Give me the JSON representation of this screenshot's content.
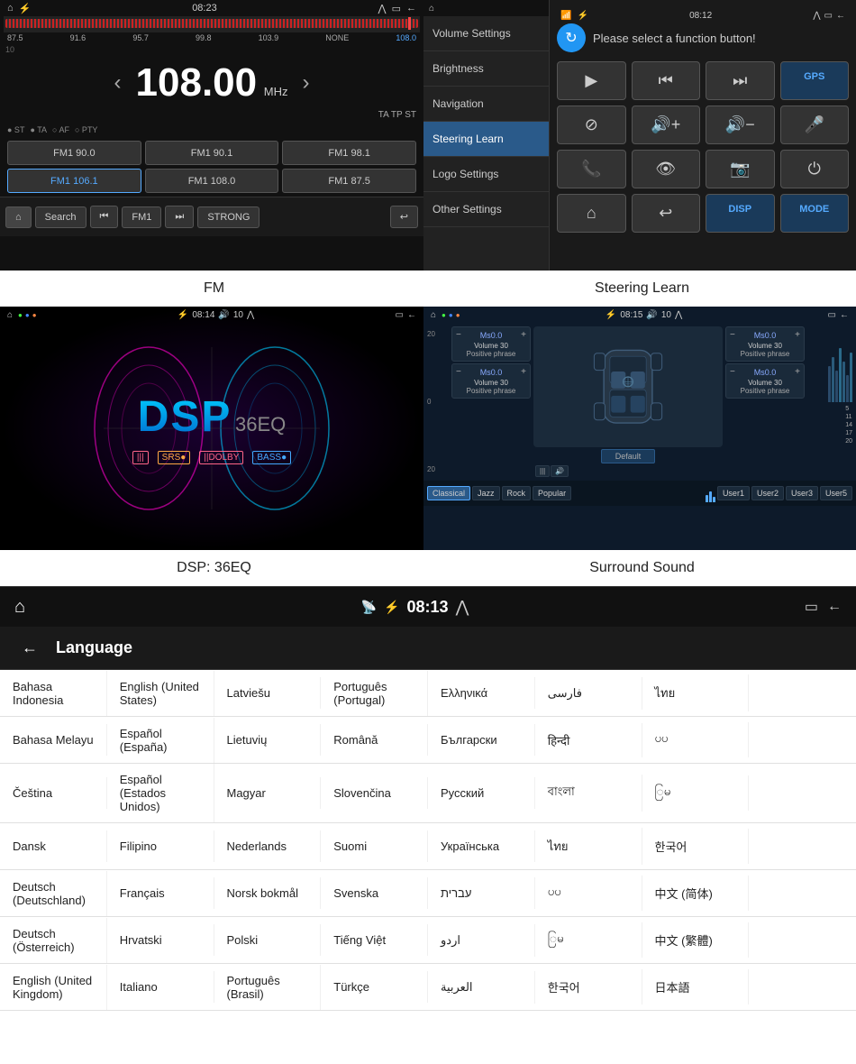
{
  "fm": {
    "title": "FM",
    "status_time": "08:23",
    "freq_display": "108.00",
    "freq_unit": "MHz",
    "freq_min": "87.5",
    "freq_bands": [
      "87.5",
      "91.6",
      "95.7",
      "99.8",
      "103.9",
      "NONE",
      "108.0"
    ],
    "band_labels": [
      "FM1",
      "ST",
      "TA",
      "AF",
      "PTY"
    ],
    "active_freq": "108.0",
    "tags": "TA  TP  ST",
    "presets": [
      "FM1 90.0",
      "FM1 90.1",
      "FM1 98.1",
      "FM1 106.1",
      "FM1 108.0",
      "FM1 87.5"
    ],
    "bottom_btns": {
      "home": "⌂",
      "search": "Search",
      "prev": "⏮",
      "band": "FM1",
      "next": "⏭",
      "strong": "STRONG",
      "back": "↩"
    }
  },
  "steering": {
    "title": "Steering Learn",
    "header_text": "Please select a function button!",
    "sidebar_items": [
      "Volume Settings",
      "Brightness",
      "Navigation",
      "Steering Learn",
      "Logo Settings",
      "Other Settings"
    ],
    "active_sidebar": "Steering Learn",
    "buttons": {
      "play": "▶",
      "prev": "⏮",
      "next": "⏭",
      "gps": "GPS",
      "mute": "⊘",
      "vol_up": "🔊+",
      "vol_down": "🔊-",
      "mic": "🎤",
      "phone": "📞",
      "eye": "👁",
      "cam": "📷",
      "power": "⏻",
      "home": "⌂",
      "back": "↩",
      "disp": "DISP",
      "mode": "MODE"
    }
  },
  "dsp": {
    "title": "DSP",
    "subtitle": "36EQ",
    "label": "DSP: 36EQ",
    "status_time": "08:14",
    "badges": [
      "|||",
      "SRS●",
      "||DOLBY",
      "BASS●"
    ]
  },
  "surround": {
    "title": "Surround Sound",
    "status_time": "08:15",
    "channels": {
      "fl": {
        "label": "Ms0.0",
        "vol": "Volume 30",
        "phrase": "Positive phrase"
      },
      "fr": {
        "label": "Ms0.0",
        "vol": "Volume 30",
        "phrase": "Positive phrase"
      },
      "rl": {
        "label": "Ms0.0",
        "vol": "Volume 30",
        "phrase": "Positive phrase"
      },
      "rr": {
        "label": "Ms0.0",
        "vol": "Volume 30",
        "phrase": "Positive phrase"
      }
    },
    "default_btn": "Default",
    "presets": [
      "Classical",
      "Jazz",
      "Rock",
      "Popular",
      "",
      "User1",
      "User2",
      "User3",
      "User5"
    ]
  },
  "language": {
    "title": "Language",
    "status_time": "08:13",
    "back_icon": "←",
    "rows": [
      [
        "Bahasa Indonesia",
        "English (United States)",
        "Latviešu",
        "Português (Portugal)",
        "Ελληνικά",
        "فارسی",
        "ไทย",
        ""
      ],
      [
        "Bahasa Melayu",
        "Español (España)",
        "Lietuvių",
        "Română",
        "Български",
        "हिन्दी",
        "ပပ",
        ""
      ],
      [
        "Čeština",
        "Español (Estados Unidos)",
        "Magyar",
        "Slovenčina",
        "Русский",
        "বাংলা",
        "ြမ",
        ""
      ],
      [
        "Dansk",
        "Filipino",
        "Nederlands",
        "Suomi",
        "Українська",
        "ไทย",
        "한국어",
        ""
      ],
      [
        "Deutsch (Deutschland)",
        "Français",
        "Norsk bokmål",
        "Svenska",
        "עברית",
        "ပပ",
        "中文 (简体)",
        ""
      ],
      [
        "Deutsch (Österreich)",
        "Hrvatski",
        "Polski",
        "Tiếng Việt",
        "اردو",
        "ြမ",
        "中文 (繁體)",
        ""
      ],
      [
        "English (United Kingdom)",
        "Italiano",
        "Português (Brasil)",
        "Türkçe",
        "العربية",
        "한국어",
        "日本語",
        ""
      ]
    ]
  },
  "labels": {
    "fm": "FM",
    "steering_learn": "Steering Learn",
    "dsp_36eq": "DSP: 36EQ",
    "surround_sound": "Surround Sound"
  }
}
